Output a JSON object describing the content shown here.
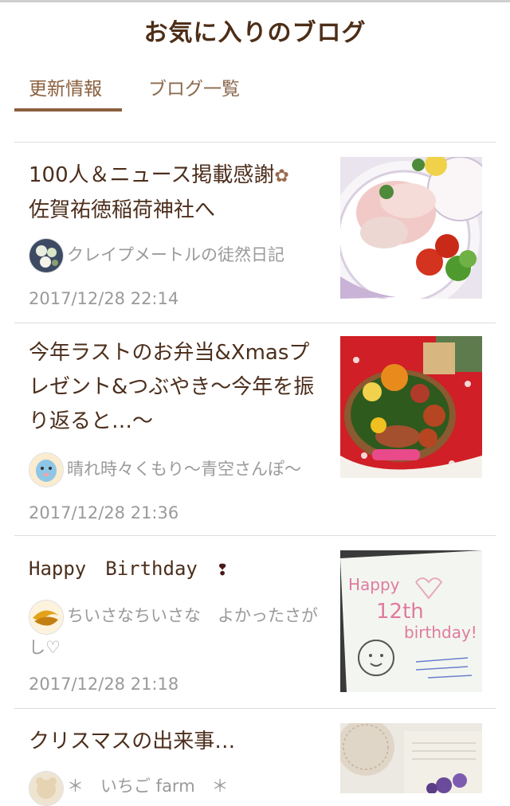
{
  "page": {
    "title": "お気に入りのブログ"
  },
  "tabs": [
    {
      "label": "更新情報",
      "active": true
    },
    {
      "label": "ブログ一覧",
      "active": false
    }
  ],
  "colors": {
    "accent": "#8b5e3c",
    "title": "#4d2e17",
    "meta": "#9a9a9a"
  },
  "entries": [
    {
      "title": "100人＆ニュース掲載感謝",
      "title_icon": "flower-icon",
      "title_line2": "佐賀祐徳稲荷神社へ",
      "blog": "クレイプメートルの徒然日記",
      "date": "2017/12/28 22:14",
      "thumb": "food-plate-ham-tomato"
    },
    {
      "title": "今年ラストのお弁当&Xmasプレゼント&つぶやき～今年を振り返ると…～",
      "blog": "晴れ時々くもり～青空さんぽ～",
      "date": "2017/12/28 21:36",
      "thumb": "bento-box-red-cloth"
    },
    {
      "title": "Happy　Birthday　",
      "title_icon": "exclamation-icon",
      "blog": "ちいさなちいさな　よかったさがし♡",
      "date": "2017/12/28 21:18",
      "thumb": "birthday-card-drawing",
      "card_text": [
        "Happy",
        "12th",
        "birthday!"
      ]
    },
    {
      "title": "クリスマスの出来事…",
      "blog": "＊　いちご farm　＊",
      "thumb": "lace-doily-flowers"
    }
  ]
}
